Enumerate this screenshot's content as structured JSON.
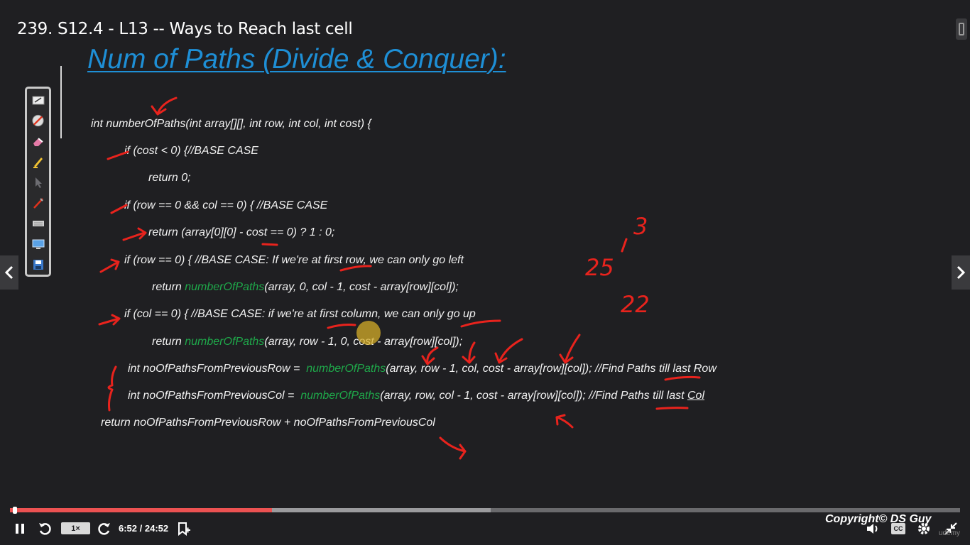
{
  "video": {
    "title": "239. S12.4 - L13 -- Ways to Reach last cell"
  },
  "slide": {
    "heading": "Num of Paths (Divide & Conquer):",
    "code_lines": [
      {
        "text": "int numberOfPaths(int array[][], int row, int col, int cost) {"
      },
      {
        "text": "if (cost < 0) {//BASE CASE"
      },
      {
        "text": "return 0;"
      },
      {
        "text": "if (row == 0 && col == 0) { //BASE CASE"
      },
      {
        "text": "return (array[0][0] - cost == 0) ? 1 : 0;"
      },
      {
        "text": "if (row == 0) { //BASE CASE: If we're at first row, we can only go left"
      },
      {
        "pre": "return ",
        "fn": "numberOfPaths",
        "post": "(array, 0, col - 1, cost - array[row][col]);"
      },
      {
        "text": "if (col == 0) { //BASE CASE: if we're at first column, we can only go up"
      },
      {
        "pre": "return ",
        "fn": "numberOfPaths",
        "post": "(array, row - 1, 0, cost - array[row][col]);"
      },
      {
        "pre": "int noOfPathsFromPreviousRow =  ",
        "fn": "numberOfPaths",
        "post": "(array, row - 1, col, cost - array[row][col]); //Find Paths till last Row"
      },
      {
        "pre": "int noOfPathsFromPreviousCol =  ",
        "fn": "numberOfPaths",
        "post": "(array, row, col - 1, cost - array[row][col]); //Find Paths till last ",
        "ul": "Col"
      },
      {
        "text": "return noOfPathsFromPreviousRow + noOfPathsFromPreviousCol"
      }
    ],
    "annotations": {
      "note_3": "3",
      "note_25": "25",
      "note_22": "22"
    }
  },
  "player": {
    "speed": "1×",
    "time_display": "6:52 / 24:52",
    "progress_fraction": 0.276,
    "buffer_fraction": 0.506,
    "copyright": "Copyright© DS Guy",
    "cc_label": "CC",
    "watermark": "udemy"
  },
  "colors": {
    "background": "#1f1f22",
    "heading": "#1e8fd6",
    "function_name": "#1fa84a",
    "annotation": "#e8231d",
    "progress": "#ec5252"
  },
  "icons": {
    "prev": "chevron-left-icon",
    "next": "chevron-right-icon",
    "pause": "pause-icon",
    "rewind": "rewind-icon",
    "forward": "forward-icon",
    "bookmark": "bookmark-add-icon",
    "volume": "volume-icon",
    "settings": "gear-icon",
    "fullscreen": "fullscreen-icon"
  }
}
